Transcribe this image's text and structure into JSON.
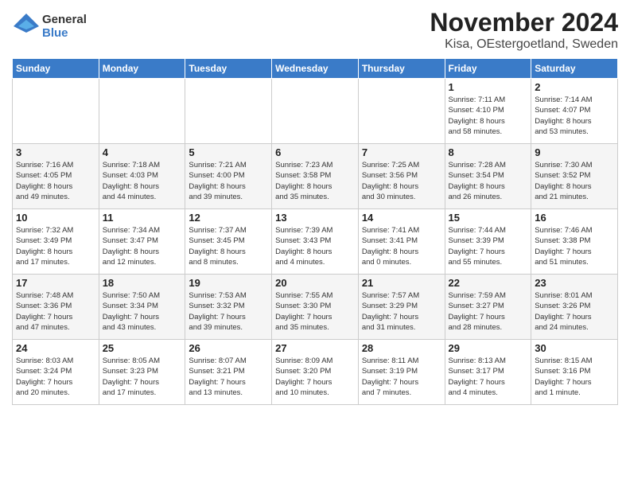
{
  "logo": {
    "line1": "General",
    "line2": "Blue"
  },
  "title": "November 2024",
  "location": "Kisa, OEstergoetland, Sweden",
  "weekdays": [
    "Sunday",
    "Monday",
    "Tuesday",
    "Wednesday",
    "Thursday",
    "Friday",
    "Saturday"
  ],
  "weeks": [
    [
      {
        "day": "",
        "info": ""
      },
      {
        "day": "",
        "info": ""
      },
      {
        "day": "",
        "info": ""
      },
      {
        "day": "",
        "info": ""
      },
      {
        "day": "",
        "info": ""
      },
      {
        "day": "1",
        "info": "Sunrise: 7:11 AM\nSunset: 4:10 PM\nDaylight: 8 hours\nand 58 minutes."
      },
      {
        "day": "2",
        "info": "Sunrise: 7:14 AM\nSunset: 4:07 PM\nDaylight: 8 hours\nand 53 minutes."
      }
    ],
    [
      {
        "day": "3",
        "info": "Sunrise: 7:16 AM\nSunset: 4:05 PM\nDaylight: 8 hours\nand 49 minutes."
      },
      {
        "day": "4",
        "info": "Sunrise: 7:18 AM\nSunset: 4:03 PM\nDaylight: 8 hours\nand 44 minutes."
      },
      {
        "day": "5",
        "info": "Sunrise: 7:21 AM\nSunset: 4:00 PM\nDaylight: 8 hours\nand 39 minutes."
      },
      {
        "day": "6",
        "info": "Sunrise: 7:23 AM\nSunset: 3:58 PM\nDaylight: 8 hours\nand 35 minutes."
      },
      {
        "day": "7",
        "info": "Sunrise: 7:25 AM\nSunset: 3:56 PM\nDaylight: 8 hours\nand 30 minutes."
      },
      {
        "day": "8",
        "info": "Sunrise: 7:28 AM\nSunset: 3:54 PM\nDaylight: 8 hours\nand 26 minutes."
      },
      {
        "day": "9",
        "info": "Sunrise: 7:30 AM\nSunset: 3:52 PM\nDaylight: 8 hours\nand 21 minutes."
      }
    ],
    [
      {
        "day": "10",
        "info": "Sunrise: 7:32 AM\nSunset: 3:49 PM\nDaylight: 8 hours\nand 17 minutes."
      },
      {
        "day": "11",
        "info": "Sunrise: 7:34 AM\nSunset: 3:47 PM\nDaylight: 8 hours\nand 12 minutes."
      },
      {
        "day": "12",
        "info": "Sunrise: 7:37 AM\nSunset: 3:45 PM\nDaylight: 8 hours\nand 8 minutes."
      },
      {
        "day": "13",
        "info": "Sunrise: 7:39 AM\nSunset: 3:43 PM\nDaylight: 8 hours\nand 4 minutes."
      },
      {
        "day": "14",
        "info": "Sunrise: 7:41 AM\nSunset: 3:41 PM\nDaylight: 8 hours\nand 0 minutes."
      },
      {
        "day": "15",
        "info": "Sunrise: 7:44 AM\nSunset: 3:39 PM\nDaylight: 7 hours\nand 55 minutes."
      },
      {
        "day": "16",
        "info": "Sunrise: 7:46 AM\nSunset: 3:38 PM\nDaylight: 7 hours\nand 51 minutes."
      }
    ],
    [
      {
        "day": "17",
        "info": "Sunrise: 7:48 AM\nSunset: 3:36 PM\nDaylight: 7 hours\nand 47 minutes."
      },
      {
        "day": "18",
        "info": "Sunrise: 7:50 AM\nSunset: 3:34 PM\nDaylight: 7 hours\nand 43 minutes."
      },
      {
        "day": "19",
        "info": "Sunrise: 7:53 AM\nSunset: 3:32 PM\nDaylight: 7 hours\nand 39 minutes."
      },
      {
        "day": "20",
        "info": "Sunrise: 7:55 AM\nSunset: 3:30 PM\nDaylight: 7 hours\nand 35 minutes."
      },
      {
        "day": "21",
        "info": "Sunrise: 7:57 AM\nSunset: 3:29 PM\nDaylight: 7 hours\nand 31 minutes."
      },
      {
        "day": "22",
        "info": "Sunrise: 7:59 AM\nSunset: 3:27 PM\nDaylight: 7 hours\nand 28 minutes."
      },
      {
        "day": "23",
        "info": "Sunrise: 8:01 AM\nSunset: 3:26 PM\nDaylight: 7 hours\nand 24 minutes."
      }
    ],
    [
      {
        "day": "24",
        "info": "Sunrise: 8:03 AM\nSunset: 3:24 PM\nDaylight: 7 hours\nand 20 minutes."
      },
      {
        "day": "25",
        "info": "Sunrise: 8:05 AM\nSunset: 3:23 PM\nDaylight: 7 hours\nand 17 minutes."
      },
      {
        "day": "26",
        "info": "Sunrise: 8:07 AM\nSunset: 3:21 PM\nDaylight: 7 hours\nand 13 minutes."
      },
      {
        "day": "27",
        "info": "Sunrise: 8:09 AM\nSunset: 3:20 PM\nDaylight: 7 hours\nand 10 minutes."
      },
      {
        "day": "28",
        "info": "Sunrise: 8:11 AM\nSunset: 3:19 PM\nDaylight: 7 hours\nand 7 minutes."
      },
      {
        "day": "29",
        "info": "Sunrise: 8:13 AM\nSunset: 3:17 PM\nDaylight: 7 hours\nand 4 minutes."
      },
      {
        "day": "30",
        "info": "Sunrise: 8:15 AM\nSunset: 3:16 PM\nDaylight: 7 hours\nand 1 minute."
      }
    ]
  ]
}
